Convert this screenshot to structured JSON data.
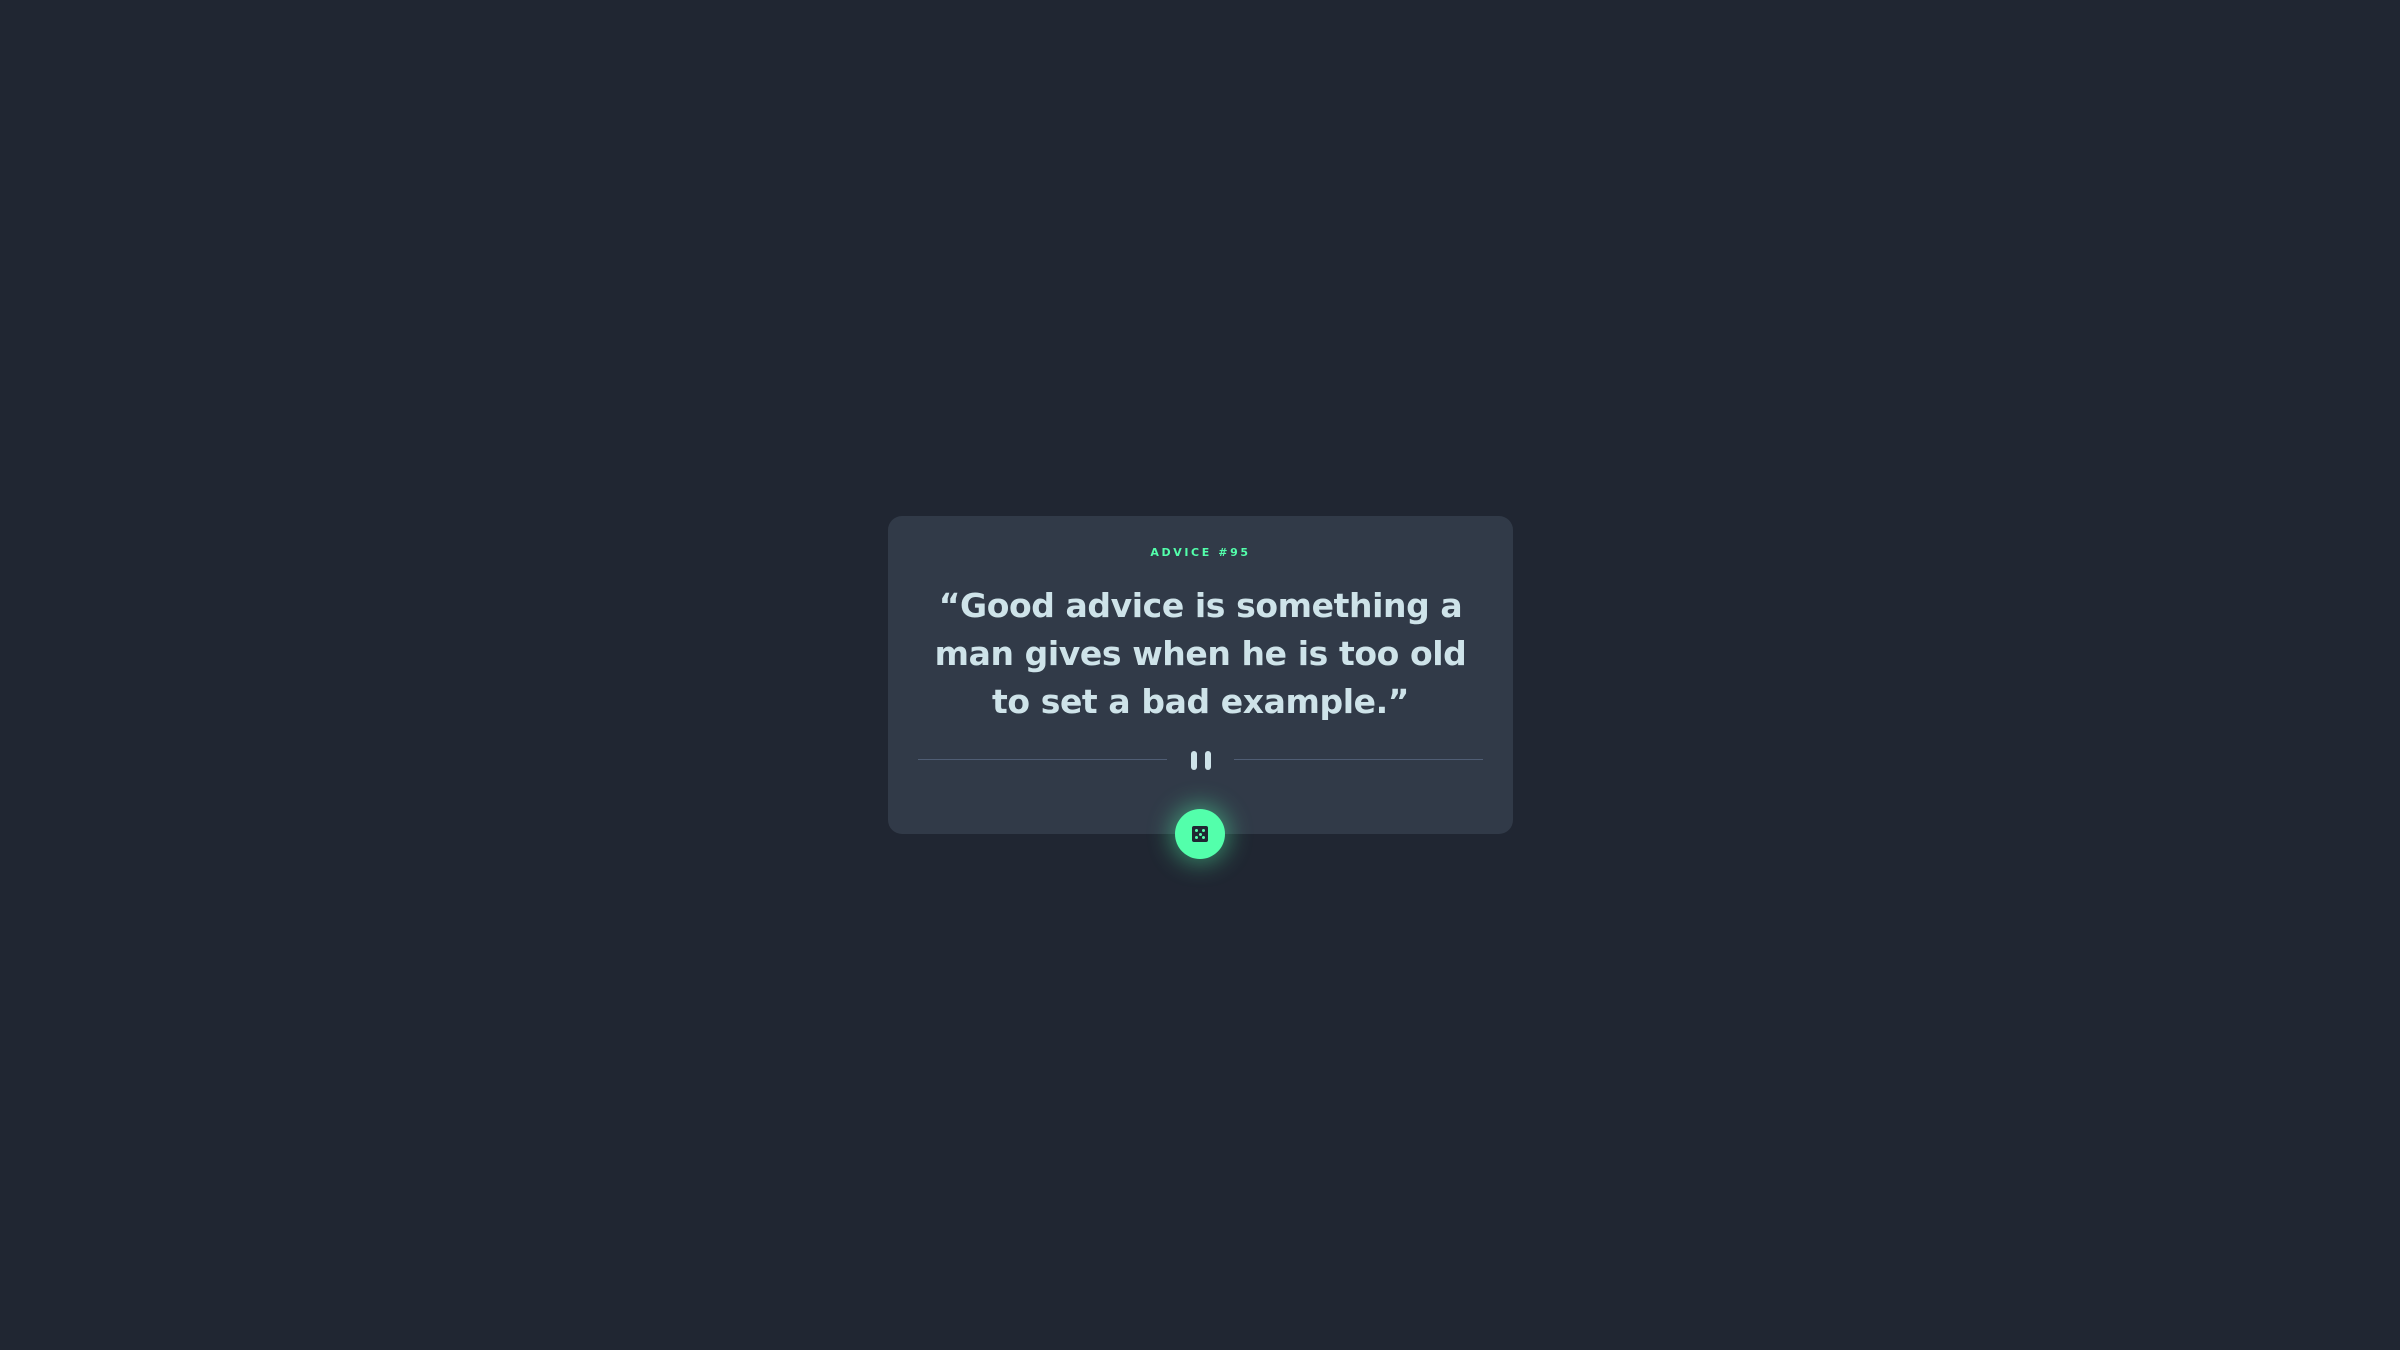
{
  "advice": {
    "id_label": "ADVICE #95",
    "quote": "“Good advice is something a man gives when he is too old to set a bad example.”"
  },
  "icons": {
    "divider": "pause-icon",
    "button": "dice-icon"
  },
  "colors": {
    "background": "#202632",
    "card": "#313a48",
    "accent": "#53ffab",
    "text": "#cee3e9",
    "divider": "#4f5d74"
  }
}
